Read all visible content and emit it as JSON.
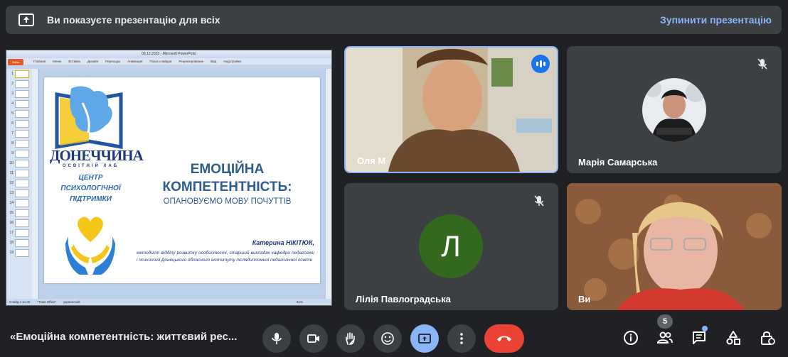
{
  "banner": {
    "text": "Ви показуєте презентацію для всіх",
    "stop_label": "Зупинити презентацію",
    "icon": "present-screen-icon"
  },
  "presentation": {
    "window_title": "09.12.2023 - Microsoft PowerPoint",
    "office_button": "Файл",
    "ribbon_tabs": [
      "Главная",
      "Меню",
      "Вставка",
      "Дизайн",
      "Переходы",
      "Анимация",
      "Показ слайдов",
      "Рецензирование",
      "Вид",
      "Надстройки"
    ],
    "thumb_numbers": [
      "1",
      "2",
      "3",
      "4",
      "5",
      "6",
      "7",
      "8",
      "9",
      "10",
      "11",
      "12",
      "13",
      "14",
      "15",
      "16",
      "17",
      "18",
      "19"
    ],
    "status": [
      "Слайд 1 из 32",
      "\"Тема Office\"",
      "украинский",
      "81%"
    ],
    "slide": {
      "brand": "ДОНЕЧЧИНА",
      "brand_sub": "ОСВІТНІЙ ХАБ",
      "center": [
        "ЦЕНТР",
        "ПСИХОЛОГІЧНОЇ",
        "ПІДТРИМКИ"
      ],
      "title_line1": "ЕМОЦІЙНА",
      "title_line2": "КОМПЕТЕНТНІСТЬ:",
      "subtitle": "ОПАНОВУЄМО МОВУ ПОЧУТТІВ",
      "author": "Катерина НІКІТЮК,",
      "description": "методист відділу розвитку особистості, старший викладач кафедри педагогіки і психології Донецького обласного інституту післядипломної педагогічної освіти"
    }
  },
  "participants": [
    {
      "name": "Оля М",
      "state": "speaking"
    },
    {
      "name": "Марія Самарська",
      "state": "muted"
    },
    {
      "name": "Лілія Павлоградська",
      "state": "muted",
      "initial": "Л"
    },
    {
      "name": "Ви",
      "state": "self"
    }
  ],
  "bottom": {
    "meeting_title": "«Емоційна компетентність: життєвий рес...",
    "participants_count": "5",
    "controls": [
      "mic-icon",
      "camera-icon",
      "raise-hand-icon",
      "emoji-icon",
      "present-screen-icon",
      "more-options-icon",
      "hang-up-icon"
    ],
    "side_icons": [
      "info-icon",
      "people-icon",
      "chat-icon",
      "activities-icon",
      "host-controls-icon"
    ]
  },
  "colors": {
    "background": "#202124",
    "tile": "#3c4043",
    "accent": "#8ab4f8",
    "hangup": "#ea4335",
    "avatar": "#33691e"
  }
}
